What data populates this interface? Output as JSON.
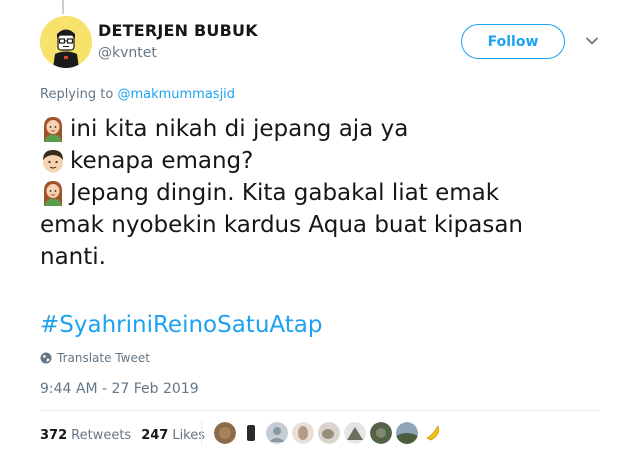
{
  "user": {
    "name": "DETERJEN BUBUK",
    "handle": "@kvntet",
    "follow_label": "Follow"
  },
  "reply": {
    "prefix": "Replying to ",
    "mention": "@makmummasjid"
  },
  "tweet": {
    "lines": [
      {
        "speaker": "woman-emoji",
        "text": "ini kita nikah di jepang aja ya"
      },
      {
        "speaker": "boy-emoji",
        "text": "kenapa emang?"
      },
      {
        "speaker": "woman-emoji",
        "text": "Jepang dingin. Kita gabakal liat emak"
      },
      {
        "speaker": null,
        "text": "emak nyobekin kardus Aqua buat kipasan"
      },
      {
        "speaker": null,
        "text": "nanti."
      }
    ],
    "hashtag": "#SyahriniReinoSatuAtap",
    "translate_label": "Translate Tweet",
    "timestamp": "9:44 AM - 27 Feb 2019"
  },
  "stats": {
    "retweets_count": "372",
    "retweets_label": "Retweets",
    "likes_count": "247",
    "likes_label": "Likes"
  },
  "likers": [
    {
      "icon": "liker-avatar-1",
      "color": "#8c6a4a"
    },
    {
      "icon": "liker-avatar-2",
      "color": "#2b2b2b"
    },
    {
      "icon": "liker-avatar-3",
      "color": "#c5ccd3"
    },
    {
      "icon": "liker-avatar-4",
      "color": "#b59a86"
    },
    {
      "icon": "liker-avatar-5",
      "color": "#9a8c7a"
    },
    {
      "icon": "liker-avatar-6",
      "color": "#6d6f5d"
    },
    {
      "icon": "liker-avatar-7",
      "color": "#55624a"
    },
    {
      "icon": "liker-avatar-8",
      "color": "#4b5e3c"
    },
    {
      "icon": "liker-avatar-9",
      "color": "#f0c419"
    }
  ],
  "colors": {
    "accent": "#1da1f2",
    "muted": "#657786",
    "text": "#14171a"
  }
}
